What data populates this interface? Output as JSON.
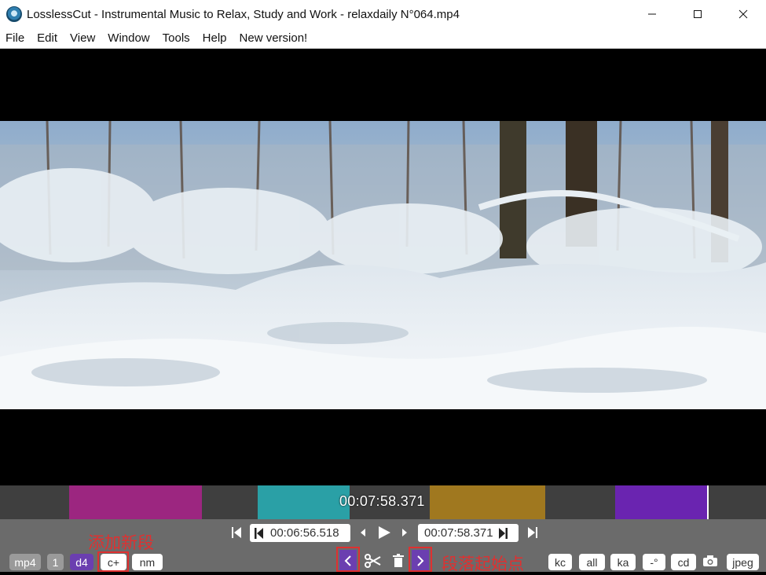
{
  "window": {
    "title": "LosslessCut - Instrumental Music to Relax, Study and Work - relaxdaily N°064.mp4",
    "minimize_icon": "minimize-icon",
    "maximize_icon": "maximize-icon",
    "close_icon": "close-icon"
  },
  "menu": [
    "File",
    "Edit",
    "View",
    "Window",
    "Tools",
    "Help",
    "New version!"
  ],
  "timeline": {
    "current_time": "00:07:58.371",
    "segments": [
      {
        "color": "#9c2680"
      },
      {
        "color": "#2aa0a6"
      },
      {
        "color": "#a0781f"
      },
      {
        "color": "#6a24b0"
      }
    ]
  },
  "transport": {
    "start_time": "00:06:56.518",
    "end_time": "00:07:58.371"
  },
  "bottom_left": {
    "format": "mp4",
    "tracks": "1",
    "d4": "d4",
    "add_segment": "c+",
    "nm": "nm"
  },
  "bottom_right": {
    "kc": "kc",
    "all": "all",
    "ka": "ka",
    "rotation": "-°",
    "cd": "cd",
    "jpeg": "jpeg"
  },
  "annotations": {
    "add_segment": "添加新段",
    "segment_start": "段落起始点"
  },
  "colors": {
    "annotation_red": "#e03030",
    "accent_purple": "#6b3fb0"
  }
}
